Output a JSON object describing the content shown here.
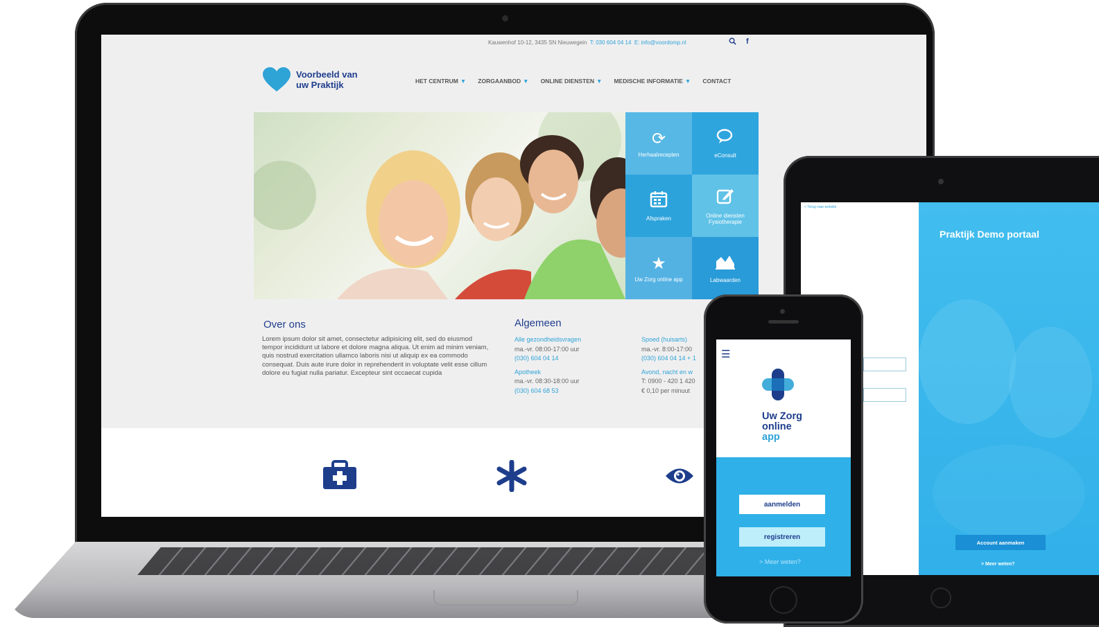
{
  "website": {
    "topbar": {
      "address": "Kauwenhof 10-12, 3435 SN Nieuwegein",
      "phone": "T: 030 604 04 14",
      "email": "E: info@voordomp.nl",
      "search_icon": "search-icon",
      "facebook_icon": "facebook-icon"
    },
    "logo": {
      "line1": "Voorbeeld van",
      "line2": "uw Praktijk",
      "icon": "heart-icon"
    },
    "nav": [
      {
        "label": "HET CENTRUM",
        "dropdown": true
      },
      {
        "label": "ZORGAANBOD",
        "dropdown": true
      },
      {
        "label": "ONLINE DIENSTEN",
        "dropdown": true
      },
      {
        "label": "MEDISCHE INFORMATIE",
        "dropdown": true
      },
      {
        "label": "CONTACT",
        "dropdown": false
      }
    ],
    "tiles": [
      {
        "label": "Herhaalrecepten",
        "icon": "refresh-icon"
      },
      {
        "label": "eConsult",
        "icon": "chat-icon"
      },
      {
        "label": "Afspraken",
        "icon": "calendar-icon"
      },
      {
        "label": "Online diensten Fysiotherapie",
        "icon": "edit-icon"
      },
      {
        "label": "Uw Zorg online app",
        "icon": "star-icon"
      },
      {
        "label": "Labwaarden",
        "icon": "chart-icon"
      }
    ],
    "over": {
      "title": "Over ons",
      "body": "Lorem ipsum dolor sit amet, consectetur adipisicing elit, sed do eiusmod tempor incididunt ut labore et dolore magna aliqua. Ut enim ad minim veniam, quis nostrud exercitation ullamco laboris nisi ut aliquip ex ea commodo consequat. Duis aute irure dolor in reprehenderit in voluptate velit esse cillum dolore eu fugiat nulla pariatur. Excepteur sint occaecat cupida"
    },
    "algemeen": {
      "title": "Algemeen",
      "col1": {
        "h1": "Alle gezondheidsvragen",
        "l1": "ma.-vr. 08:00-17:00 uur",
        "l2": "(030) 604 04 14",
        "h2": "Apotheek",
        "l3": "ma.-vr. 08:30-18:00 uur",
        "l4": "(030) 604 68 53"
      },
      "col2": {
        "h1": "Spoed (huisarts)",
        "l1": "ma.-vr. 8:00-17:00",
        "l2": "(030) 604 04 14 + 1",
        "h2": "Avond, nacht en w",
        "l3": "T: 0900 - 420 1 420",
        "l4": "€ 0,10 per minuut"
      }
    },
    "bottom_icons": [
      "medical-kit-icon",
      "asterisk-icon",
      "eye-icon"
    ]
  },
  "tablet": {
    "back_link": "< Terug naar website",
    "title": "Praktijk Demo portaal",
    "account_button": "Account aanmaken",
    "more_link": "> Meer weten?"
  },
  "phone": {
    "menu_icon": "hamburger-icon",
    "logo_line1": "Uw Zorg",
    "logo_line2": "online",
    "logo_line3": "app",
    "login_button": "aanmelden",
    "register_button": "registreren",
    "more_link": "> Meer weten?"
  },
  "colors": {
    "brand_navy": "#1e3e8c",
    "brand_cyan": "#2ea3d6",
    "tile_blue": "#34a8e0",
    "phone_blue": "#2fb0e8"
  }
}
